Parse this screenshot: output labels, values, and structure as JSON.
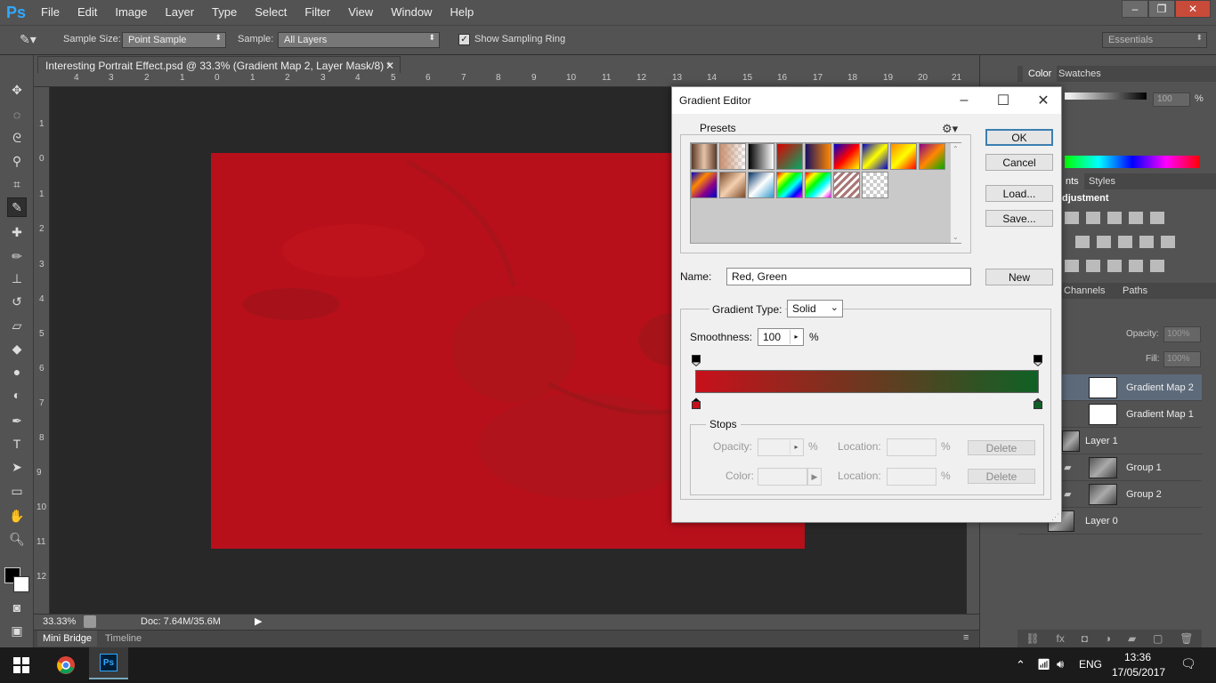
{
  "app": {
    "logo": "Ps"
  },
  "menu": [
    "File",
    "Edit",
    "Image",
    "Layer",
    "Type",
    "Select",
    "Filter",
    "View",
    "Window",
    "Help"
  ],
  "window_controls": {
    "minimize": "–",
    "restore": "❐",
    "close": "✕"
  },
  "options_bar": {
    "sample_size_label": "Sample Size:",
    "sample_size_value": "Point Sample",
    "sample_label": "Sample:",
    "sample_value": "All Layers",
    "show_ring_label": "Show Sampling Ring",
    "show_ring_checked": true,
    "workspace": "Essentials"
  },
  "document": {
    "tab_title": "Interesting Portrait Effect.psd @ 33.3% (Gradient Map 2, Layer Mask/8) *",
    "zoom": "33.33%",
    "doc_info": "Doc: 7.64M/35.6M"
  },
  "ruler_top": [
    "4",
    "3",
    "2",
    "1",
    "0",
    "1",
    "2",
    "3",
    "4",
    "5",
    "6",
    "7",
    "8",
    "9",
    "10",
    "11",
    "12",
    "13",
    "14",
    "15",
    "16",
    "17",
    "18",
    "19",
    "20",
    "21"
  ],
  "ruler_left": [
    "1",
    "0",
    "1",
    "2",
    "3",
    "4",
    "5",
    "6",
    "7",
    "8",
    "9",
    "10",
    "11",
    "12"
  ],
  "bottom_tabs": [
    "Mini Bridge",
    "Timeline"
  ],
  "right_panel": {
    "color_tabs": [
      "Color",
      "Swatches"
    ],
    "opacity_pct": "100",
    "pct": "%",
    "adj_tabs": [
      "nts",
      "Styles"
    ],
    "adjustment_label": "djustment",
    "layer_tabs": [
      "Channels",
      "Paths"
    ],
    "opacity_label": "Opacity:",
    "opacity_value": "100%",
    "fill_label": "Fill:",
    "fill_value": "100%",
    "layers": [
      {
        "name": "Gradient Map 2",
        "selected": true
      },
      {
        "name": "Gradient Map 1",
        "selected": false
      },
      {
        "name": "Layer 1",
        "selected": false
      },
      {
        "name": "Group 1",
        "selected": false
      },
      {
        "name": "Group 2",
        "selected": false
      },
      {
        "name": "Layer 0",
        "selected": false
      }
    ]
  },
  "dialog": {
    "title": "Gradient Editor",
    "presets_label": "Presets",
    "ok": "OK",
    "cancel": "Cancel",
    "load": "Load...",
    "save": "Save...",
    "name_label": "Name:",
    "name_value": "Red, Green",
    "new": "New",
    "gradient_type_label": "Gradient Type:",
    "gradient_type_value": "Solid",
    "smoothness_label": "Smoothness:",
    "smoothness_value": "100",
    "pct": "%",
    "gradient_colors": {
      "start": "#c8101b",
      "end": "#0f6125"
    },
    "stops_label": "Stops",
    "opacity_label": "Opacity:",
    "color_label": "Color:",
    "location_label": "Location:",
    "delete": "Delete"
  },
  "taskbar": {
    "lang": "ENG",
    "time": "13:36",
    "date": "17/05/2017"
  }
}
